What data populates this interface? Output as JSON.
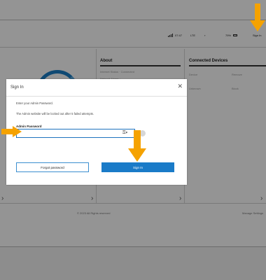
{
  "colors": {
    "accent": "#1a7bc8",
    "arrow": "#f5a200"
  },
  "header": {
    "time": "07:47",
    "network": "LTE",
    "battery": "79%",
    "signin_link": "Sign In"
  },
  "columns": {
    "about_title": "About",
    "connected_title": "Connected Devices",
    "about_rows": [
      "Internet Status · Connected",
      "Network Name · ..."
    ],
    "connected_rows": [
      {
        "name": "Device",
        "status": "Remove"
      },
      {
        "name": "Unknown",
        "status": "Block"
      }
    ]
  },
  "footer": {
    "copyright": "© 2023 All Rights reserved",
    "link": "Manage Settings"
  },
  "dialog": {
    "title": "Sign In",
    "close_icon": "close-icon",
    "prompt": "Enter your Admin Password.",
    "warning": "The Admin website will be locked out after 5 failed attempts.",
    "field_label": "Admin Password",
    "password_value": "",
    "key_icon": "key-icon",
    "forgot_label": "Forgot password",
    "signin_label": "Sign In"
  }
}
